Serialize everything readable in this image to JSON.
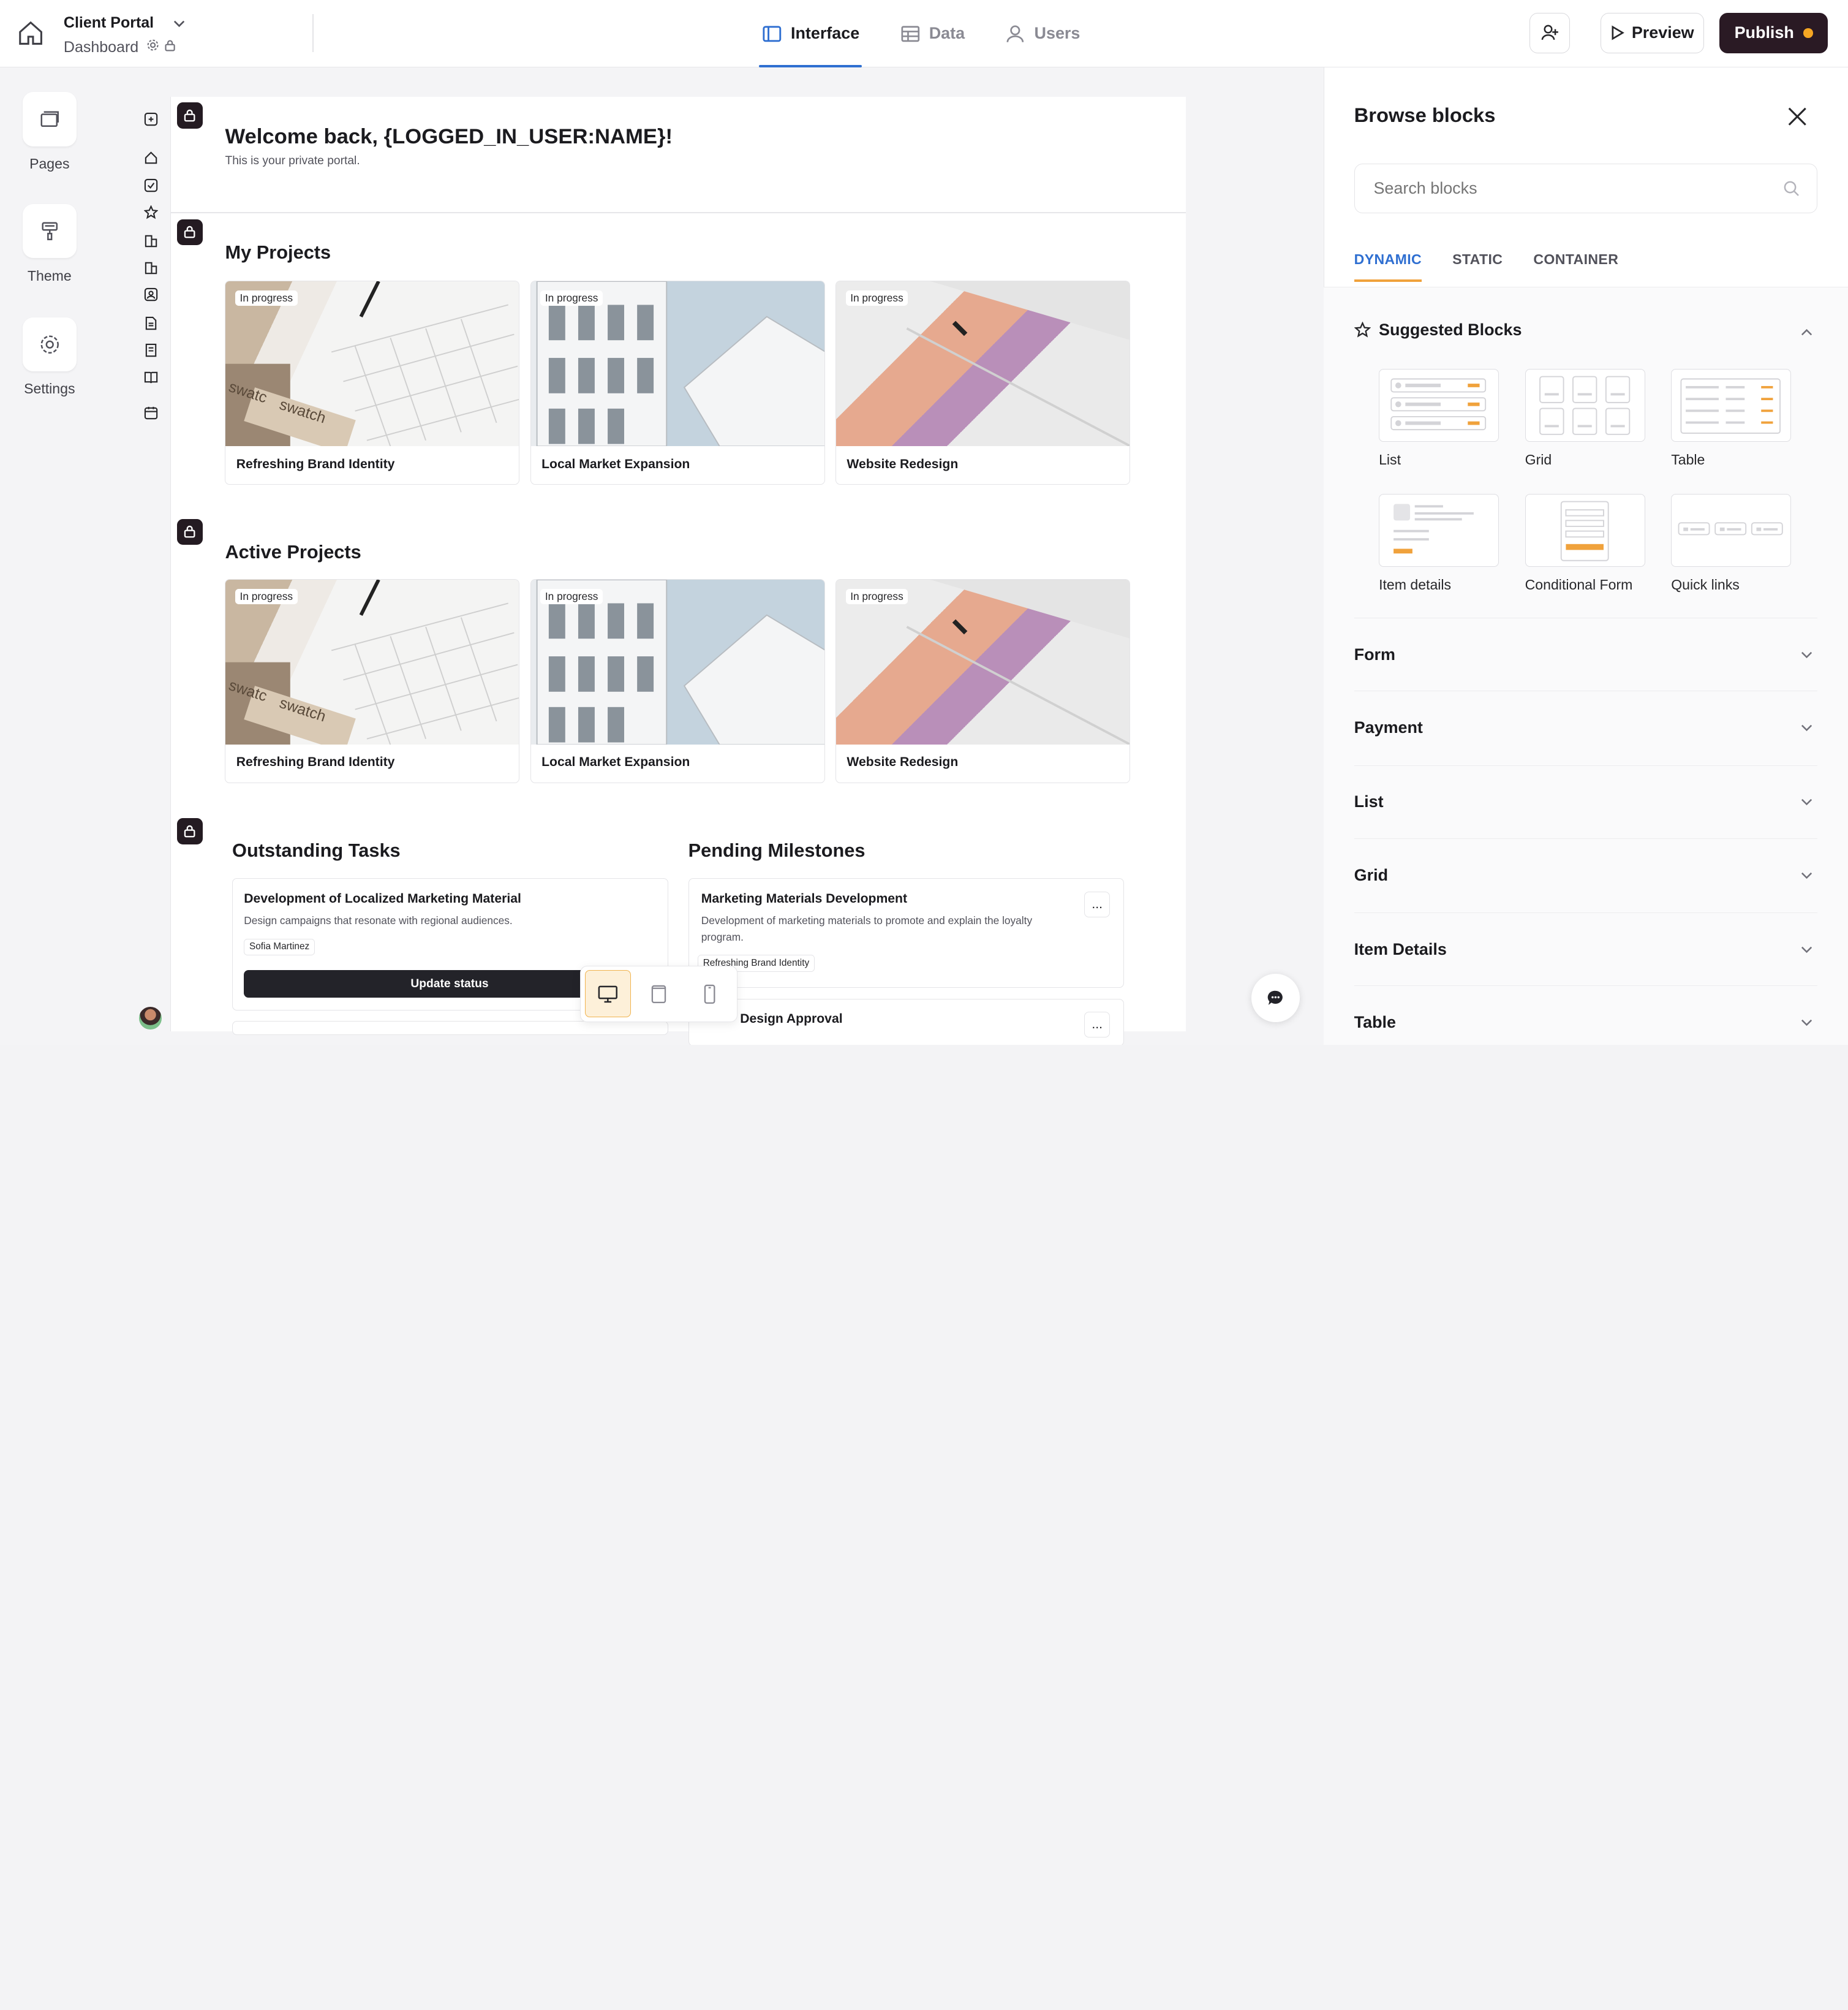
{
  "header": {
    "app_title": "Client Portal",
    "page_name": "Dashboard",
    "tabs": [
      {
        "label": "Interface",
        "active": true
      },
      {
        "label": "Data",
        "active": false
      },
      {
        "label": "Users",
        "active": false
      }
    ],
    "preview_label": "Preview",
    "publish_label": "Publish",
    "publish_dot_color": "#f5a623",
    "accent_color": "#2f6fd1"
  },
  "rail": {
    "items": [
      {
        "label": "Pages",
        "icon": "pages-icon"
      },
      {
        "label": "Theme",
        "icon": "paint-roller-icon"
      },
      {
        "label": "Settings",
        "icon": "gear-icon"
      }
    ]
  },
  "canvas": {
    "welcome_title": "Welcome back, {LOGGED_IN_USER:NAME}!",
    "welcome_subtitle": "This is your private portal.",
    "sections": [
      {
        "title": "My Projects",
        "cards": [
          {
            "badge": "In progress",
            "title": "Refreshing Brand Identity"
          },
          {
            "badge": "In progress",
            "title": "Local Market Expansion"
          },
          {
            "badge": "In progress",
            "title": "Website Redesign"
          }
        ]
      },
      {
        "title": "Active Projects",
        "cards": [
          {
            "badge": "In progress",
            "title": "Refreshing Brand Identity"
          },
          {
            "badge": "In progress",
            "title": "Local Market Expansion"
          },
          {
            "badge": "In progress",
            "title": "Website Redesign"
          }
        ]
      }
    ],
    "tasks": {
      "title": "Outstanding Tasks",
      "item": {
        "title": "Development of Localized Marketing Material",
        "description": "Design campaigns that resonate with regional audiences.",
        "assignee": "Sofia Martinez",
        "button_label": "Update status"
      }
    },
    "milestones": {
      "title": "Pending Milestones",
      "item": {
        "title": "Marketing Materials Development",
        "description": "Development of marketing materials to promote and explain the loyalty program.",
        "project": "Refreshing Brand Identity",
        "more_label": "..."
      },
      "next_item_title": "Design Approval",
      "next_more_label": "..."
    }
  },
  "panel": {
    "title": "Browse blocks",
    "search_placeholder": "Search blocks",
    "tabs": [
      {
        "label": "DYNAMIC",
        "active": true
      },
      {
        "label": "STATIC",
        "active": false
      },
      {
        "label": "CONTAINER",
        "active": false
      }
    ],
    "suggested_title": "Suggested Blocks",
    "suggested": [
      {
        "label": "List"
      },
      {
        "label": "Grid"
      },
      {
        "label": "Table"
      },
      {
        "label": "Item details"
      },
      {
        "label": "Conditional Form"
      },
      {
        "label": "Quick links"
      }
    ],
    "sections": [
      {
        "label": "Form"
      },
      {
        "label": "Payment"
      },
      {
        "label": "List"
      },
      {
        "label": "Grid"
      },
      {
        "label": "Item Details"
      },
      {
        "label": "Table"
      }
    ]
  }
}
